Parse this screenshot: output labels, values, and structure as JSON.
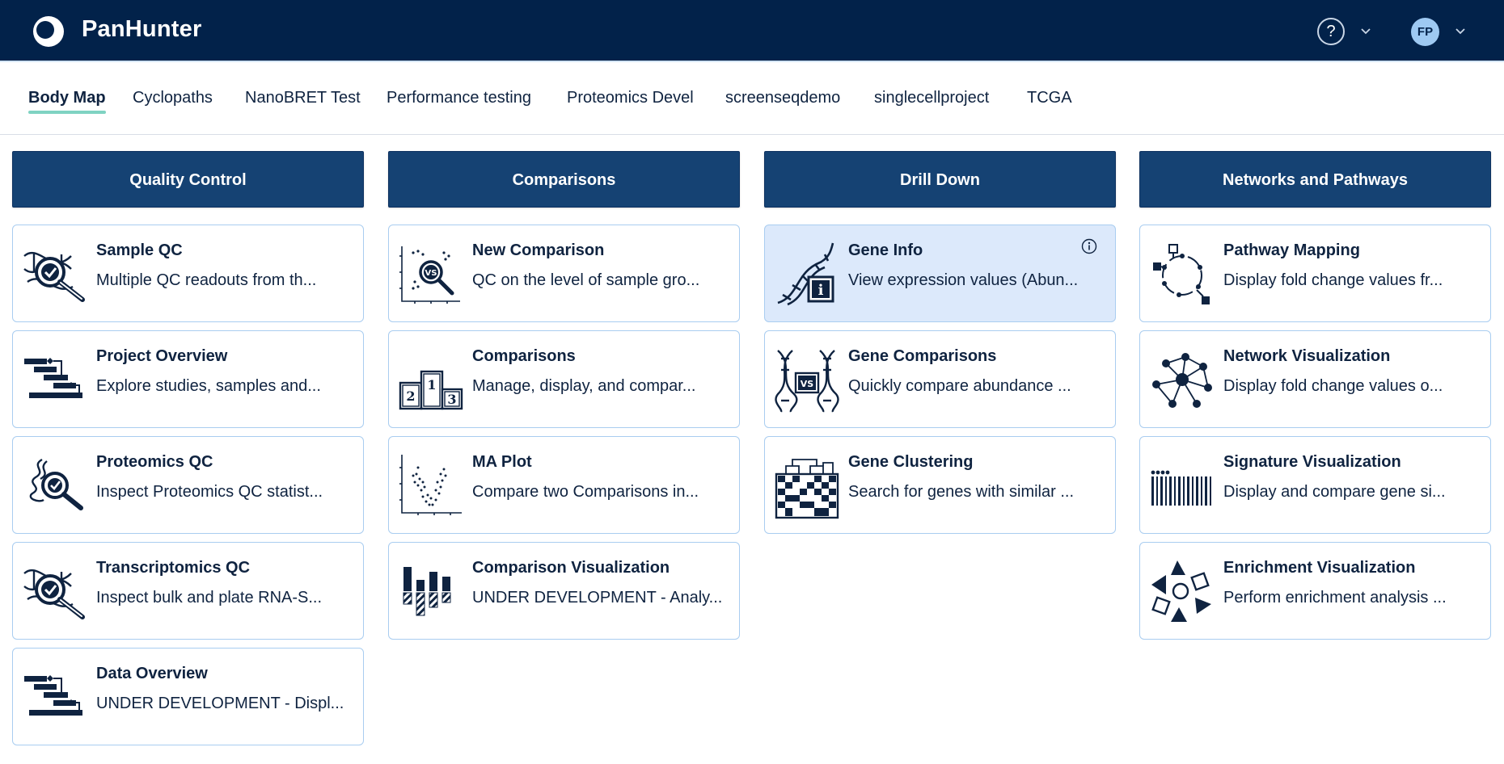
{
  "app": {
    "title": "PanHunter",
    "help_label": "?",
    "user_initials": "FP"
  },
  "tabs": [
    {
      "label": "Body Map",
      "active": true
    },
    {
      "label": "Cyclopaths"
    },
    {
      "label": "NanoBRET Test"
    },
    {
      "label": "Performance testing"
    },
    {
      "label": "Proteomics Devel"
    },
    {
      "label": "screenseqdemo"
    },
    {
      "label": "singlecellproject"
    },
    {
      "label": "TCGA"
    }
  ],
  "columns": [
    {
      "header": "Quality Control",
      "cards": [
        {
          "title": "Sample QC",
          "desc": "Multiple QC readouts from th...",
          "icon": "dna-check-magnifier-icon"
        },
        {
          "title": "Project Overview",
          "desc": "Explore studies, samples and...",
          "icon": "hierarchy-bars-icon"
        },
        {
          "title": "Proteomics QC",
          "desc": "Inspect Proteomics QC statist...",
          "icon": "protein-check-magnifier-icon"
        },
        {
          "title": "Transcriptomics QC",
          "desc": "Inspect bulk and plate RNA-S...",
          "icon": "dna-check-magnifier-icon"
        },
        {
          "title": "Data Overview",
          "desc": "UNDER DEVELOPMENT - Displ...",
          "icon": "hierarchy-bars-icon"
        }
      ]
    },
    {
      "header": "Comparisons",
      "cards": [
        {
          "title": "New Comparison",
          "desc": "QC on the level of sample gro...",
          "icon": "scatter-vs-magnifier-icon"
        },
        {
          "title": "Comparisons",
          "desc": "Manage, display, and compar...",
          "icon": "podium-icon",
          "podium": [
            "2",
            "1",
            "3"
          ]
        },
        {
          "title": "MA Plot",
          "desc": "Compare two Comparisons in...",
          "icon": "volcano-plot-icon"
        },
        {
          "title": "Comparison Visualization",
          "desc": "UNDER DEVELOPMENT - Analy...",
          "icon": "bar-comparison-icon"
        }
      ]
    },
    {
      "header": "Drill Down",
      "cards": [
        {
          "title": "Gene Info",
          "desc": "View expression values (Abun...",
          "icon": "dna-info-icon",
          "highlight": true
        },
        {
          "title": "Gene Comparisons",
          "desc": "Quickly compare abundance ...",
          "icon": "dna-vs-icon"
        },
        {
          "title": "Gene Clustering",
          "desc": "Search for genes with similar ...",
          "icon": "heatmap-dendrogram-icon"
        }
      ]
    },
    {
      "header": "Networks and Pathways",
      "cards": [
        {
          "title": "Pathway Mapping",
          "desc": "Display fold change values fr...",
          "icon": "pathway-cycle-icon"
        },
        {
          "title": "Network Visualization",
          "desc": "Display fold change values o...",
          "icon": "network-nodes-icon"
        },
        {
          "title": "Signature Visualization",
          "desc": "Display and compare gene si...",
          "icon": "barcode-signature-icon"
        },
        {
          "title": "Enrichment Visualization",
          "desc": "Perform enrichment analysis ...",
          "icon": "shapes-enrichment-icon"
        }
      ]
    }
  ],
  "colors": {
    "topbar": "#02224a",
    "header": "#154273",
    "card_border": "#a9cdf0",
    "highlight": "#dce9fb",
    "tab_underline": "#7fd3c2",
    "icon": "#0f2340"
  }
}
